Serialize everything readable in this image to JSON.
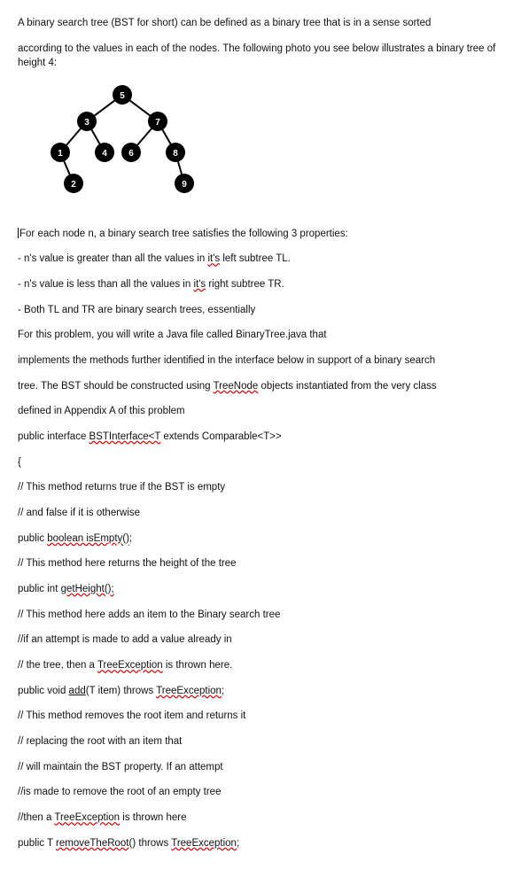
{
  "intro1": "A binary search tree (BST for short) can be defined as a binary tree that is in a sense sorted",
  "intro2": "according to the values in each of the nodes. The following photo you see below illustrates a binary tree of height 4:",
  "props_lead": "or each node n, a binary search tree satisfies the following 3 properties:",
  "prop1_a": "- n's value is greater than all the values in ",
  "prop1_link": "it's",
  "prop1_b": " left subtree TL.",
  "prop2_a": "- n's value is less than all the values in ",
  "prop2_link": "it's",
  "prop2_b": " right subtree TR.",
  "prop3": "- Both TL and TR are binary search trees, essentially",
  "para1": "For this problem, you will write a Java file called BinaryTree.java that",
  "para2": "implements the methods further identified in the interface below in support of a binary search",
  "para3_a": "tree. The BST should be constructed using ",
  "para3_err": "TreeNode",
  "para3_b": " objects instantiated from the very class",
  "para4": "defined in Appendix A of this problem",
  "iface_a": "public interface ",
  "iface_err": "BSTInterface<T",
  "iface_b": " extends Comparable<T>>",
  "brace": "{",
  "c1": "// This method returns true if the BST is empty",
  "c2": "// and false if it is otherwise",
  "m1_a": "public ",
  "m1_err": "boolean isEmpty();",
  "c3": "// This method here returns the height of the tree",
  "m2_a": "public int ",
  "m2_err": "getHeight();",
  "c4": "// This method here adds an item to the Binary search tree",
  "c5": "//if an attempt is made to add a value already in",
  "c6_a": "// the tree, then a ",
  "c6_err": "TreeException",
  "c6_b": " is thrown here.",
  "m3_a": "public void ",
  "m3_u": "add",
  "m3_b": "(T item) throws ",
  "m3_err": "TreeException;",
  "c7": "// This method removes the root item and returns it",
  "c8": "// replacing the root with an item that",
  "c9": "// will maintain the BST property. If an attempt",
  "c10": "//is made to remove the root of an empty tree",
  "c11_a": "//then  a ",
  "c11_err": "TreeException",
  "c11_b": " is thrown here",
  "m4_a": "public T ",
  "m4_err1": "removeTheRoot",
  "m4_b": "() throws ",
  "m4_err2": "TreeException;",
  "tree": {
    "n1": "1",
    "n2": "2",
    "n3": "3",
    "n4": "4",
    "n5": "5",
    "n6": "6",
    "n7": "7",
    "n8": "8",
    "n9": "9"
  }
}
